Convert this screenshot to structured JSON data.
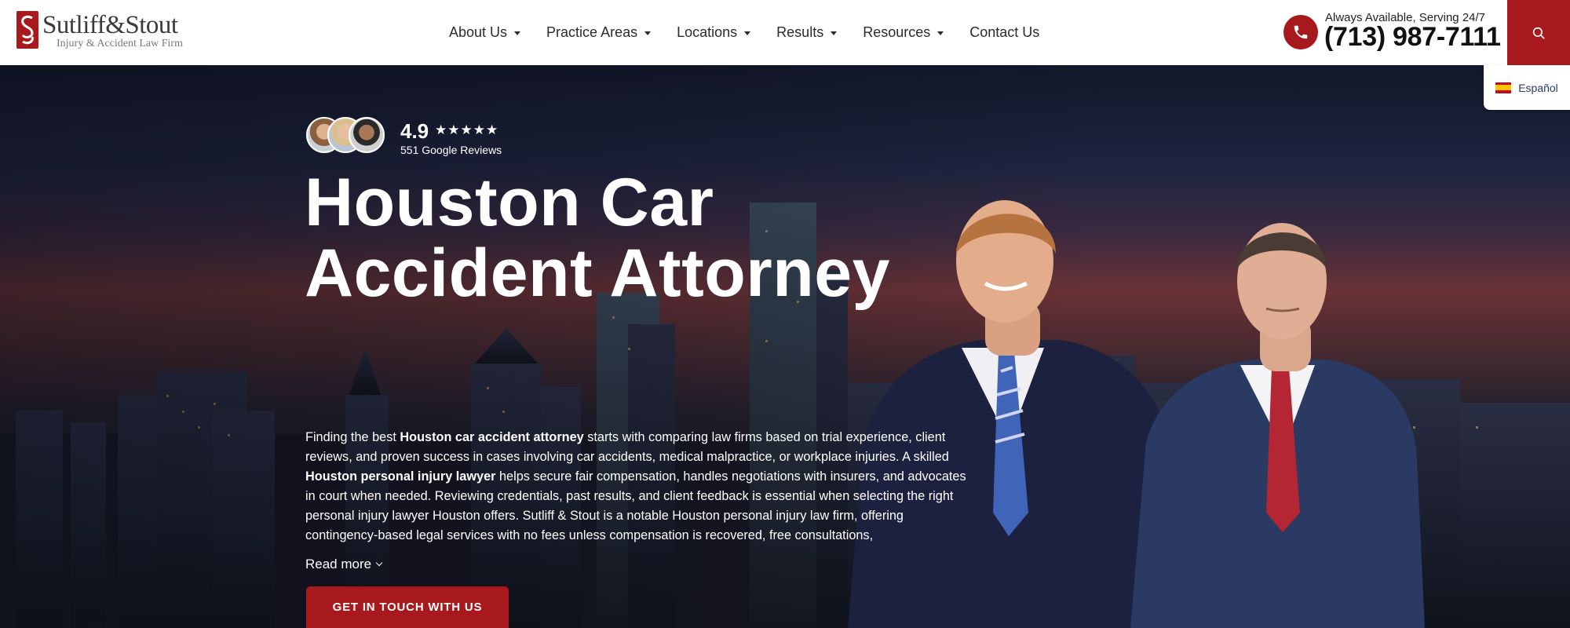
{
  "brand": {
    "name": "Sutliff&Stout",
    "tagline": "Injury & Accident Law Firm",
    "colors": {
      "primary_red": "#a8191d",
      "header_bg": "#ffffff",
      "text_dark": "#2b2b2b"
    }
  },
  "nav": {
    "items": [
      {
        "label": "About Us",
        "dropdown": true
      },
      {
        "label": "Practice Areas",
        "dropdown": true
      },
      {
        "label": "Locations",
        "dropdown": true
      },
      {
        "label": "Results",
        "dropdown": true
      },
      {
        "label": "Resources",
        "dropdown": true
      },
      {
        "label": "Contact Us",
        "dropdown": false
      }
    ]
  },
  "contact": {
    "availability": "Always Available, Serving 24/7",
    "phone": "(713) 987-7111",
    "icon": "phone-icon"
  },
  "search": {
    "icon": "search-icon"
  },
  "language": {
    "label": "Español",
    "icon": "spain-flag-icon"
  },
  "hero": {
    "rating": "4.9",
    "stars": "★★★★★",
    "review_count": "551 Google Reviews",
    "title_line1": "Houston Car",
    "title_line2": "Accident Attorney",
    "body": {
      "p1": "Finding the best ",
      "b1": "Houston car accident  attorney",
      "p2": " starts with comparing law firms based on trial experience, client reviews, and proven success in cases involving car accidents, medical malpractice, or workplace injuries. A skilled ",
      "b2": "Houston personal injury lawyer",
      "p3": " helps secure fair compensation, handles negotiations with insurers, and advocates in court when needed. Reviewing credentials, past results, and client feedback is essential when selecting the right personal injury lawyer Houston offers. Sutliff & Stout is a notable Houston personal injury law firm, offering contingency-based legal services with no fees unless compensation is recovered, free consultations,"
    },
    "read_more": "Read more",
    "cta": "GET IN TOUCH WITH US"
  }
}
